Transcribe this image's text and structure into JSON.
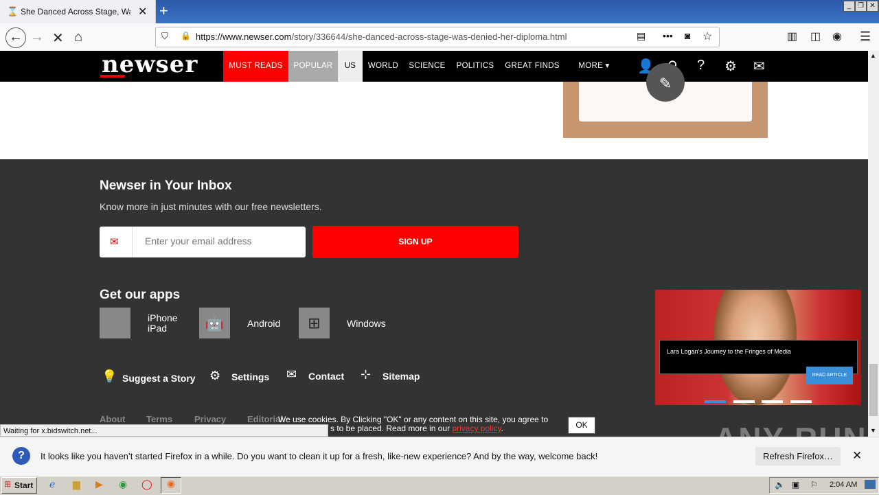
{
  "browser": {
    "tab_title": "She Danced Across Stage, Was De",
    "url_host": "https://www.newser.com",
    "url_path": "/story/336644/she-danced-across-stage-was-denied-her-diploma.html",
    "status_text": "Waiting for x.bidswitch.net..."
  },
  "site": {
    "logo": "newser",
    "nav": [
      "MUST READS",
      "POPULAR",
      "US",
      "WORLD",
      "SCIENCE",
      "POLITICS",
      "GREAT FINDS",
      "MORE ▾"
    ]
  },
  "newsletter": {
    "title": "Newser in Your Inbox",
    "description": "Know more in just minutes with our free newsletters.",
    "email_placeholder": "Enter your email address",
    "signup_label": "SIGN UP"
  },
  "apps": {
    "title": "Get our apps",
    "items": [
      "iPhone",
      "iPad",
      "Android",
      "Windows"
    ]
  },
  "footer_links": [
    "Suggest a Story",
    "Settings",
    "Contact",
    "Sitemap"
  ],
  "bottom_links": [
    "About",
    "Terms",
    "Privacy",
    "Editorial"
  ],
  "promo": {
    "title": "Lara Logan's Journey to the Fringes of Media",
    "button": "READ ARTICLE"
  },
  "cookie": {
    "line1": "We use cookies. By Clicking \"OK\" or any content on this site, you agree to",
    "line2": "s to be placed. Read more in our ",
    "link": "privacy policy",
    "ok": "OK"
  },
  "notification": {
    "message": "It looks like you haven’t started Firefox in a while. Do you want to clean it up for a fresh, like-new experience? And by the way, welcome back!",
    "button": "Refresh Firefox…"
  },
  "taskbar": {
    "start": "Start",
    "clock": "2:04 AM"
  },
  "watermark": "ANY RUN"
}
